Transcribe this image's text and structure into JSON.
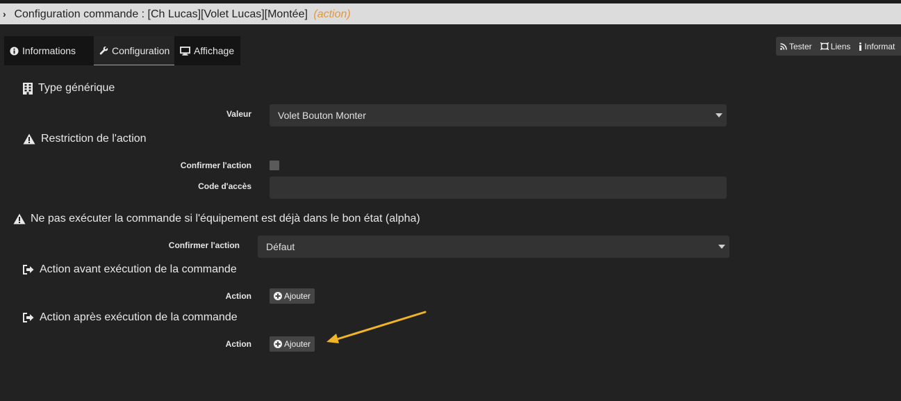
{
  "title": {
    "main": "Configuration commande : [Ch Lucas][Volet Lucas][Montée]",
    "type": "(action)"
  },
  "tabs": [
    {
      "label": "Informations",
      "icon": "info-circle-icon"
    },
    {
      "label": "Configuration",
      "icon": "wrench-icon"
    },
    {
      "label": "Affichage",
      "icon": "monitor-icon"
    }
  ],
  "right_buttons": [
    {
      "label": "Tester",
      "icon": "rss-icon"
    },
    {
      "label": "Liens",
      "icon": "links-icon"
    },
    {
      "label": "Informat",
      "icon": "info-icon"
    }
  ],
  "generic_type": {
    "heading": "Type générique",
    "value_label": "Valeur",
    "value": "Volet Bouton Monter"
  },
  "restriction": {
    "heading": "Restriction de l'action",
    "confirm_label": "Confirmer l'action",
    "code_label": "Code d'accès"
  },
  "alpha": {
    "heading": "Ne pas exécuter la commande si l'équipement est déjà dans le bon état (alpha)",
    "confirm_label": "Confirmer l'action",
    "confirm_value": "Défaut"
  },
  "before": {
    "heading": "Action avant exécution de la commande",
    "action_label": "Action",
    "add_label": "Ajouter"
  },
  "after": {
    "heading": "Action après exécution de la commande",
    "action_label": "Action",
    "add_label": "Ajouter"
  },
  "colors": {
    "background": "#222222",
    "title_bar": "#dcdcdc",
    "accent_orange": "#e0983c",
    "tab_active_underline": "#8dc63f",
    "annotation_arrow": "#f0b429"
  }
}
